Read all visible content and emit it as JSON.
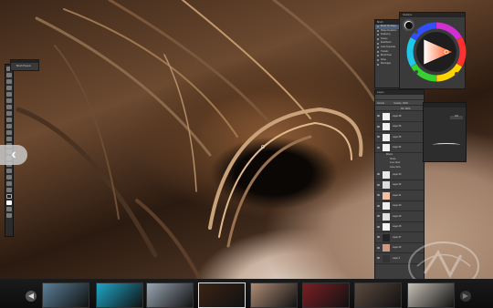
{
  "canvas": {
    "description_icon": "hair-painting-artwork"
  },
  "brush_presets_panel": {
    "title": "Brush Presets"
  },
  "nav": {
    "prev_icon": "chevron-left-icon"
  },
  "brush_panel": {
    "title": "Brush",
    "items": [
      {
        "label": "Brush Tip Shape",
        "selected": true
      },
      {
        "label": "Shape Dynamics",
        "checked": true
      },
      {
        "label": "Scattering"
      },
      {
        "label": "Texture"
      },
      {
        "label": "Dual Brush"
      },
      {
        "label": "Color Dynamics"
      },
      {
        "label": "Transfer"
      },
      {
        "label": "Brush Pose"
      },
      {
        "label": "Noise"
      },
      {
        "label": "Wet Edges"
      }
    ]
  },
  "color_panel": {
    "title": "Coolorus"
  },
  "layers_panel": {
    "title": "Layers",
    "blend_mode": "Normal",
    "opacity_label": "Opacity:",
    "opacity_value": "100%",
    "fill_label": "Fill:",
    "fill_value": "100%",
    "layers_top": [
      "Layer 38",
      "Layer 36",
      "Layer 35",
      "Layer 34"
    ],
    "effects_label": "Effects",
    "effects": [
      "Stroke",
      "Inner Glow",
      "Outer Glow"
    ],
    "layers_bottom": [
      "Layer 33",
      "Layer 32",
      "Layer 31",
      "Layer 30",
      "Layer 29",
      "Layer 28",
      "Layer 27",
      "Layer 26",
      "Layer 3"
    ]
  },
  "side_panel": {
    "value": "226"
  },
  "filmstrip": {
    "prev_icon": "circle-arrow-left-icon",
    "next_icon": "circle-arrow-right-icon",
    "thumbs": [
      {
        "color": "#5b7f98",
        "active": false
      },
      {
        "color": "#1ea7c9",
        "active": false
      },
      {
        "color": "#9aa7b5",
        "active": false
      },
      {
        "color": "#3a2416",
        "active": true
      },
      {
        "color": "#b08d75",
        "active": false
      },
      {
        "color": "#7a1f24",
        "active": false
      },
      {
        "color": "#5b4a3e",
        "active": false
      },
      {
        "color": "#c8c2b6",
        "active": false
      }
    ]
  }
}
